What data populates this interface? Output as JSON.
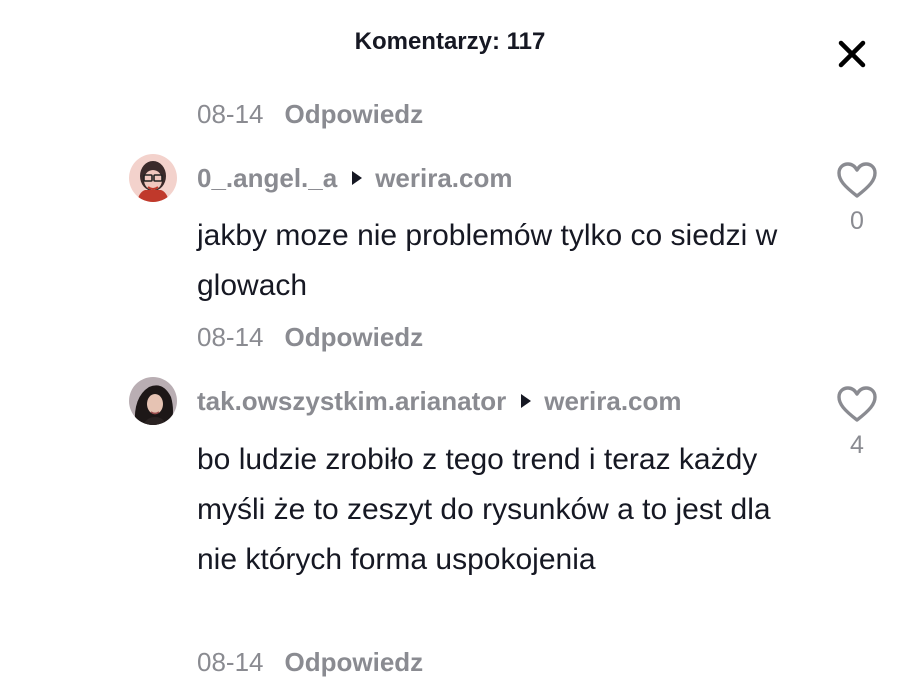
{
  "header": {
    "title": "Komentarzy: 117"
  },
  "top_meta": {
    "date": "08-14",
    "reply_label": "Odpowiedz"
  },
  "comments": [
    {
      "username": "0_.angel._a",
      "site": "werira.com",
      "text": "jakby moze nie problemów tylko co siedzi w glowach",
      "likes": "0",
      "date": "08-14",
      "reply_label": "Odpowiedz"
    },
    {
      "username": "tak.owszystkim.arianator",
      "site": "werira.com",
      "text": "bo ludzie zrobiło z tego trend i teraz każdy myśli że to zeszyt do rysunków a to jest dla nie których forma uspokojenia",
      "likes": "4",
      "date": "08-14",
      "reply_label": "Odpowiedz"
    }
  ],
  "icons": {
    "close": "close-icon",
    "like": "heart-outline-icon",
    "arrow": "triangle-right-icon"
  },
  "colors": {
    "text_primary": "#161823",
    "text_secondary": "#8a8b91",
    "background": "#ffffff"
  }
}
